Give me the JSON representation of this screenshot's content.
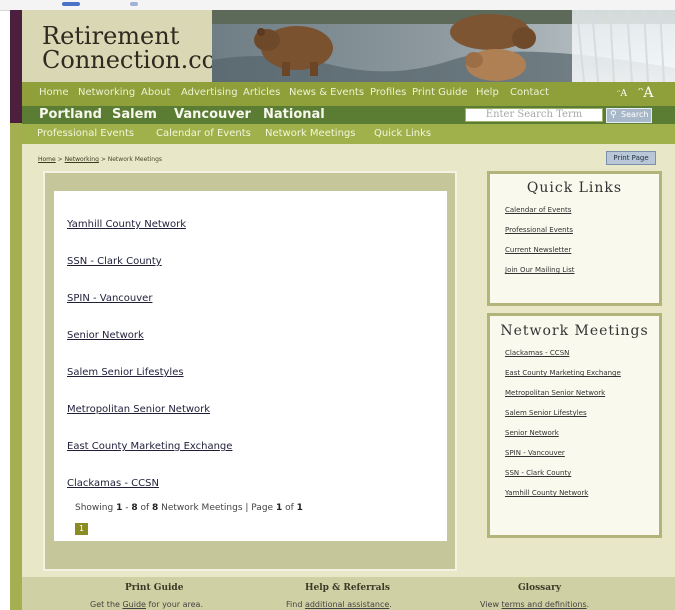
{
  "site": {
    "logo_line1": "Retirement",
    "logo_line2": "Connection.com"
  },
  "nav": {
    "items": [
      "Home",
      "Networking",
      "About",
      "Advertising",
      "Articles",
      "News & Events",
      "Profiles",
      "Print Guide",
      "Help",
      "Contact"
    ],
    "font_small": "ᵔA",
    "font_large": "ᵔA"
  },
  "cities": [
    "Portland",
    "Salem",
    "Vancouver",
    "National"
  ],
  "search": {
    "placeholder": "Enter Search Term",
    "button_label": "Search"
  },
  "subnav": [
    "Professional Events",
    "Calendar of Events",
    "Network Meetings",
    "Quick Links"
  ],
  "breadcrumb": {
    "home": "Home",
    "sep": " > ",
    "networking": "Networking",
    "current": "Network Meetings"
  },
  "print_page_label": "Print Page",
  "main": {
    "networks": [
      "Yamhill County Network",
      "SSN - Clark County",
      "SPIN - Vancouver",
      "Senior Network",
      "Salem Senior Lifestyles",
      "Metropolitan Senior Network",
      "East County Marketing Exchange",
      "Clackamas - CCSN"
    ],
    "showing": {
      "prefix": "Showing ",
      "from": "1",
      "dash": " - ",
      "to": "8",
      "of_text": " of ",
      "total": "8",
      "label": " Network Meetings | Page ",
      "page": "1",
      "page_of": " of ",
      "pages": "1"
    },
    "page_button": "1"
  },
  "quick_links": {
    "title": "Quick Links",
    "items": [
      "Calendar of Events",
      "Professional Events",
      "Current Newsletter",
      "Join Our Mailing List"
    ]
  },
  "network_meetings": {
    "title": "Network Meetings",
    "items": [
      "Clackamas - CCSN",
      "East County Marketing Exchange",
      "Metropolitan Senior Network",
      "Salem Senior Lifestyles",
      "Senior Network",
      "SPIN - Vancouver",
      "SSN - Clark County",
      "Yamhill County Network"
    ]
  },
  "footer": {
    "print_guide_title": "Print Guide",
    "print_guide_pre": "Get the ",
    "print_guide_link": "Guide",
    "print_guide_post": " for your area.",
    "help_title": "Help & Referrals",
    "help_pre": "Find ",
    "help_link": "additional assistance",
    "help_post": ".",
    "glossary_title": "Glossary",
    "glossary_pre": "View ",
    "glossary_link": "terms and definitions",
    "glossary_post": "."
  },
  "colors": {
    "nav_bg": "#8f9f3a",
    "city_bar_bg": "#5b7d33",
    "subnav_bg": "#a0b04a",
    "page_bg": "#e8e8c9",
    "accent_purple": "#4c1f3f"
  }
}
